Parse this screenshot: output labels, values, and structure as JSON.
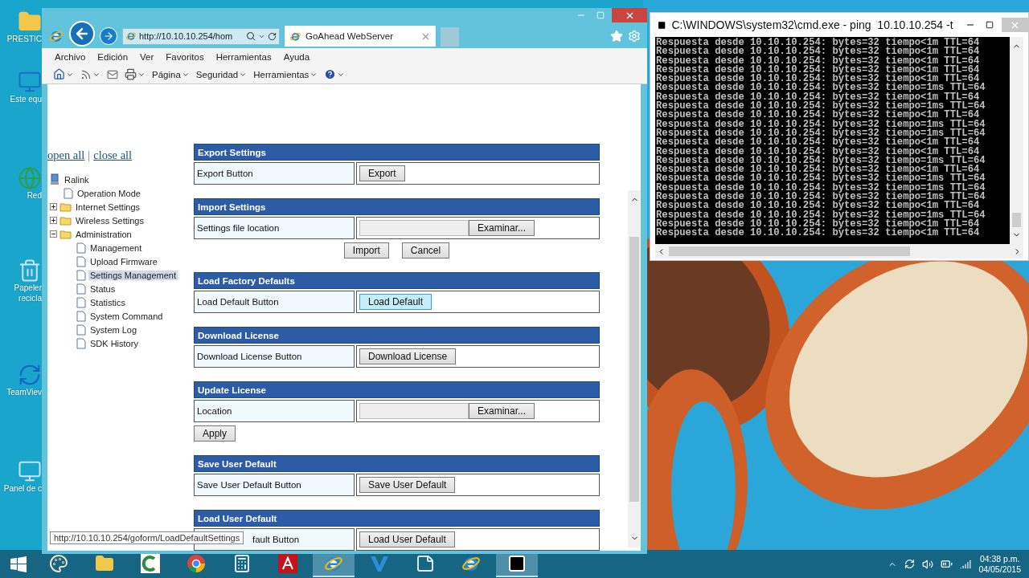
{
  "desktop_icons": [
    {
      "label": "PRESTIC",
      "kind": "folder"
    },
    {
      "label": "Este equ",
      "kind": "computer"
    },
    {
      "label": "Red",
      "kind": "network"
    },
    {
      "label": "Papeler recicla",
      "kind": "recycle"
    },
    {
      "label": "TeamViev",
      "kind": "teamviewer"
    },
    {
      "label": "Panel de c",
      "kind": "control"
    }
  ],
  "browser": {
    "address": "http://10.10.10.254/hom",
    "tab": {
      "title": "GoAhead WebServer"
    },
    "menu": [
      "Archivo",
      "Edición",
      "Ver",
      "Favoritos",
      "Herramientas",
      "Ayuda"
    ],
    "commands": [
      {
        "kind": "home"
      },
      {
        "kind": "feeds"
      },
      {
        "kind": "mail"
      },
      {
        "kind": "print"
      },
      {
        "kind": "menu",
        "label": "Página"
      },
      {
        "kind": "menu",
        "label": "Seguridad"
      },
      {
        "kind": "menu",
        "label": "Herramientas"
      },
      {
        "kind": "help"
      }
    ],
    "page": {
      "tree_links": [
        "open all",
        "close all"
      ],
      "tree_separator": "|",
      "tree": {
        "label": "Ralink",
        "children": [
          {
            "label": "Operation Mode",
            "kind": "page",
            "selected": false
          },
          {
            "label": "Internet Settings",
            "kind": "folder",
            "expanded": false
          },
          {
            "label": "Wireless Settings",
            "kind": "folder",
            "expanded": false
          },
          {
            "label": "Administration",
            "kind": "folder",
            "expanded": true,
            "children": [
              {
                "label": "Management",
                "kind": "page",
                "selected": false
              },
              {
                "label": "Upload Firmware",
                "kind": "page",
                "selected": false
              },
              {
                "label": "Settings Management",
                "kind": "page",
                "selected": true
              },
              {
                "label": "Status",
                "kind": "page",
                "selected": false
              },
              {
                "label": "Statistics",
                "kind": "page",
                "selected": false
              },
              {
                "label": "System Command",
                "kind": "page",
                "selected": false
              },
              {
                "label": "System Log",
                "kind": "page",
                "selected": false
              },
              {
                "label": "SDK History",
                "kind": "page",
                "selected": false
              }
            ]
          }
        ]
      },
      "sections": [
        {
          "title": "Export Settings",
          "rows": [
            {
              "label": "Export Button",
              "kind": "button",
              "button": "Export",
              "hovered": false,
              "covered": false
            }
          ]
        },
        {
          "title": "Import Settings",
          "rows": [
            {
              "label": "Settings file location",
              "kind": "file",
              "button": "Examinar...",
              "covered": false
            }
          ],
          "actions": {
            "buttons": [
              "Import",
              "Cancel"
            ]
          }
        },
        {
          "title": "Load Factory Defaults",
          "rows": [
            {
              "label": "Load Default Button",
              "kind": "button",
              "button": "Load Default",
              "hovered": true,
              "covered": false
            }
          ]
        },
        {
          "title": "Download License",
          "rows": [
            {
              "label": "Download License Button",
              "kind": "button",
              "button": "Download License",
              "hovered": false,
              "covered": false
            }
          ]
        },
        {
          "title": "Update License",
          "rows": [
            {
              "label": "Location",
              "kind": "file",
              "button": "Examinar...",
              "covered": false
            }
          ],
          "actions": {
            "buttons": [
              "Apply"
            ]
          }
        },
        {
          "title": "Save User Default",
          "rows": [
            {
              "label": "Save User Default Button",
              "kind": "button",
              "button": "Save User Default",
              "hovered": false,
              "covered": false
            }
          ]
        },
        {
          "title": "Load User Default",
          "rows": [
            {
              "label": "fault Button",
              "kind": "button",
              "button": "Load User Default",
              "hovered": false,
              "covered": true
            }
          ]
        }
      ],
      "status_url": "http://10.10.10.254/goform/LoadDefaultSettings"
    }
  },
  "console": {
    "title": "C:\\WINDOWS\\system32\\cmd.exe - ping  10.10.10.254 -t",
    "lines": [
      "Respuesta desde 10.10.10.254: bytes=32 tiempo<1m TTL=64",
      "Respuesta desde 10.10.10.254: bytes=32 tiempo<1m TTL=64",
      "Respuesta desde 10.10.10.254: bytes=32 tiempo<1m TTL=64",
      "Respuesta desde 10.10.10.254: bytes=32 tiempo<1m TTL=64",
      "Respuesta desde 10.10.10.254: bytes=32 tiempo<1m TTL=64",
      "Respuesta desde 10.10.10.254: bytes=32 tiempo=1ms TTL=64",
      "Respuesta desde 10.10.10.254: bytes=32 tiempo<1m TTL=64",
      "Respuesta desde 10.10.10.254: bytes=32 tiempo=1ms TTL=64",
      "Respuesta desde 10.10.10.254: bytes=32 tiempo<1m TTL=64",
      "Respuesta desde 10.10.10.254: bytes=32 tiempo=1ms TTL=64",
      "Respuesta desde 10.10.10.254: bytes=32 tiempo=1ms TTL=64",
      "Respuesta desde 10.10.10.254: bytes=32 tiempo<1m TTL=64",
      "Respuesta desde 10.10.10.254: bytes=32 tiempo<1m TTL=64",
      "Respuesta desde 10.10.10.254: bytes=32 tiempo=1ms TTL=64",
      "Respuesta desde 10.10.10.254: bytes=32 tiempo<1m TTL=64",
      "Respuesta desde 10.10.10.254: bytes=32 tiempo=1ms TTL=64",
      "Respuesta desde 10.10.10.254: bytes=32 tiempo=1ms TTL=64",
      "Respuesta desde 10.10.10.254: bytes=32 tiempo=1ms TTL=64",
      "Respuesta desde 10.10.10.254: bytes=32 tiempo<1m TTL=64",
      "Respuesta desde 10.10.10.254: bytes=32 tiempo=1ms TTL=64",
      "Respuesta desde 10.10.10.254: bytes=32 tiempo<1m TTL=64",
      "Respuesta desde 10.10.10.254: bytes=32 tiempo<1m TTL=64"
    ]
  },
  "taskbar": {
    "apps": [
      {
        "kind": "paint",
        "active": false
      },
      {
        "kind": "explorer",
        "active": false
      },
      {
        "kind": "camtasia",
        "active": false
      },
      {
        "kind": "chrome",
        "active": false
      },
      {
        "kind": "calculator",
        "active": false
      },
      {
        "kind": "adobe",
        "active": false
      },
      {
        "kind": "ie",
        "active": true
      },
      {
        "kind": "vapp",
        "active": false
      },
      {
        "kind": "notes",
        "active": false
      },
      {
        "kind": "ie",
        "active": false
      },
      {
        "kind": "cmd",
        "active": true
      }
    ],
    "clock": {
      "time": "04:38 p.m.",
      "date": "04/05/2015"
    }
  }
}
